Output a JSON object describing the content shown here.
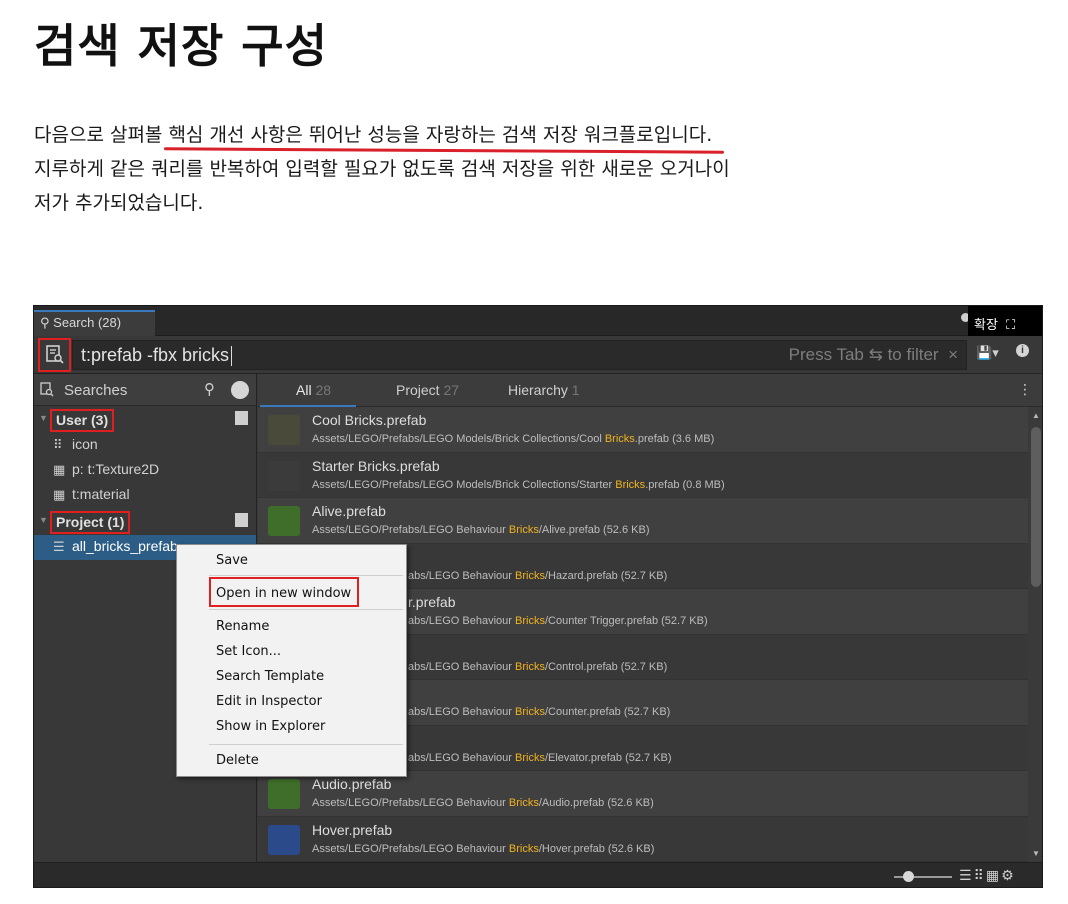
{
  "heading": "검색 저장 구성",
  "paragraph": {
    "line1_before": "다음으로 살펴볼 ",
    "line1_highlight": "핵심 개선 사항은 뛰어난 성능을 자랑하는 검색 저장 워크플로입니다.",
    "line2": "지루하게 같은 쿼리를 반복하여 입력할 필요가 없도록 검색 저장을 위한 새로운 오거나이",
    "line3": "저가 추가되었습니다."
  },
  "window": {
    "tab_label": "Search (28)",
    "expand_label": "확장",
    "query": "t:prefab -fbx bricks",
    "placeholder": "Press Tab ⇆ to filter",
    "clear_glyph": "×"
  },
  "sidebar": {
    "header": "Searches",
    "groups": [
      {
        "label": "User (3)",
        "items": [
          {
            "icon": "list-grid-icon",
            "label": "icon"
          },
          {
            "icon": "grid-icon",
            "label": "p: t:Texture2D"
          },
          {
            "icon": "grid-icon",
            "label": "t:material"
          }
        ]
      },
      {
        "label": "Project (1)",
        "items": [
          {
            "icon": "list-icon",
            "label": "all_bricks_prefab",
            "selected": true
          }
        ]
      }
    ]
  },
  "result_tabs": [
    {
      "label": "All",
      "count": "28",
      "active": true
    },
    {
      "label": "Project",
      "count": "27",
      "active": false
    },
    {
      "label": "Hierarchy",
      "count": "1",
      "active": false
    }
  ],
  "results": [
    {
      "name": "Cool Bricks.prefab",
      "path_pre": "Assets/LEGO/Prefabs/LEGO Models/Brick Collections/Cool ",
      "path_hl": "Bricks",
      "path_post": ".prefab (3.6 MB)",
      "thumb": "#4a4a3a"
    },
    {
      "name": "Starter Bricks.prefab",
      "path_pre": "Assets/LEGO/Prefabs/LEGO Models/Brick Collections/Starter ",
      "path_hl": "Bricks",
      "path_post": ".prefab (0.8 MB)",
      "thumb": "#3b3b3b"
    },
    {
      "name": "Alive.prefab",
      "path_pre": "Assets/LEGO/Prefabs/LEGO Behaviour ",
      "path_hl": "Bricks",
      "path_post": "/Alive.prefab (52.6 KB)",
      "thumb": "#3e6e2a"
    },
    {
      "name": "",
      "path_pre": "abs/LEGO Behaviour ",
      "path_hl": "Bricks",
      "path_post": "/Hazard.prefab (52.7 KB)",
      "thumb": ""
    },
    {
      "name": "r.prefab",
      "path_pre": "abs/LEGO Behaviour ",
      "path_hl": "Bricks",
      "path_post": "/Counter Trigger.prefab (52.7 KB)",
      "thumb": ""
    },
    {
      "name": "",
      "path_pre": "abs/LEGO Behaviour ",
      "path_hl": "Bricks",
      "path_post": "/Control.prefab (52.7 KB)",
      "thumb": ""
    },
    {
      "name": "",
      "path_pre": "abs/LEGO Behaviour ",
      "path_hl": "Bricks",
      "path_post": "/Counter.prefab (52.7 KB)",
      "thumb": ""
    },
    {
      "name": "",
      "path_pre": "abs/LEGO Behaviour ",
      "path_hl": "Bricks",
      "path_post": "/Elevator.prefab (52.7 KB)",
      "thumb": ""
    },
    {
      "name": "Audio.prefab",
      "path_pre": "Assets/LEGO/Prefabs/LEGO Behaviour ",
      "path_hl": "Bricks",
      "path_post": "/Audio.prefab (52.6 KB)",
      "thumb": "#3e6e2a"
    },
    {
      "name": "Hover.prefab",
      "path_pre": "Assets/LEGO/Prefabs/LEGO Behaviour ",
      "path_hl": "Bricks",
      "path_post": "/Hover.prefab (52.6 KB)",
      "thumb": "#2a4a8a"
    }
  ],
  "context_menu": {
    "save": "Save",
    "open_new_window": "Open in new window",
    "rename": "Rename",
    "set_icon": "Set Icon...",
    "search_template": "Search Template",
    "edit_in_inspector": "Edit in Inspector",
    "show_in_explorer": "Show in Explorer",
    "delete": "Delete"
  },
  "colors": {
    "highlight_underline": "#d9202b",
    "annotation_red": "#e02020",
    "selection_blue": "#2c5d87",
    "match_orange": "#f1b31f"
  }
}
